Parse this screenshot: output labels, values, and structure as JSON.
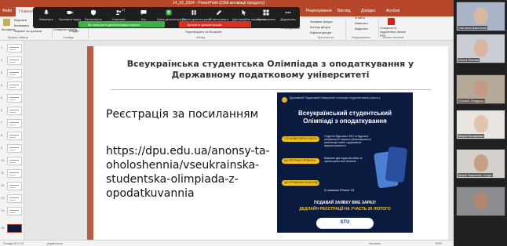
{
  "window": {
    "title": "14_02_2024 - PowerPoint (Сбій активації продукту)"
  },
  "ribbon_tabs": [
    "Файл",
    "Главная",
    "Вставка",
    "Дизайн",
    "Переходи",
    "Анімація",
    "Показ слайдів",
    "Рецензування",
    "Вигляд",
    "Довідка",
    "Acrobat"
  ],
  "ribbon": {
    "paste": "Вставити",
    "cut": "Вирізати",
    "copy": "Копіювати",
    "format": "Формат за зразком",
    "new_slide": "Створити слайд",
    "reset": "Скинути",
    "section": "Розділ",
    "clipboard_group": "Буфер обміну",
    "slides_group": "Слайди",
    "find": "Знайти",
    "replace": "Замінити",
    "select": "Виділити",
    "editing_group": "Редагування",
    "adobe": "Створити й поділитися Adobe PDF",
    "adobe_group": "Adobe Acrobat",
    "text_dir": "Напрямок тексту",
    "align_text": "Вирівняти текст",
    "smartart": "Перетворити на SmartArt",
    "paragraph_group": "Абзац",
    "arrange": "Упорядкувати",
    "quick_styles": "Експрес-стилі",
    "shape_fill": "Заливка фігури",
    "shape_outline": "Контур фігури",
    "shape_effects": "Ефекти фігури",
    "drawing_group": "Креслення"
  },
  "zoombar": {
    "buttons": [
      {
        "label": "Вимкнути",
        "color": "#ffffff"
      },
      {
        "label": "Зупинити відео",
        "color": "#ffffff"
      },
      {
        "label": "Безпечність",
        "color": "#ffffff"
      },
      {
        "label": "Учасники",
        "color": "#ffffff",
        "badge": "17"
      },
      {
        "label": "Чат",
        "color": "#ffffff"
      },
      {
        "label": "Нова демонстрація",
        "color": "#3fae49"
      },
      {
        "label": "Пауза демонстрації",
        "color": "#ffffff"
      },
      {
        "label": "Коментувати",
        "color": "#ffffff"
      },
      {
        "label": "Дистанційне керування",
        "color": "#ffffff"
      },
      {
        "label": "Приложения",
        "color": "#ffffff"
      },
      {
        "label": "Додатково",
        "color": "#ffffff"
      }
    ]
  },
  "share_status": {
    "green": "Ви запустили демонстрацію екрана",
    "red": "Зупинити демонстрацію"
  },
  "thumbnails": [
    "1",
    "2",
    "3",
    "4",
    "5",
    "6",
    "7",
    "8",
    "9",
    "10",
    "11",
    "12",
    "13",
    "14",
    "15"
  ],
  "slide": {
    "title": "Всеукраїнська студентська Олімпіада з оподаткування у Державному податковому університеті",
    "registration": "Реєстрація за посиланням",
    "url": "https://dpu.edu.ua/anonsy-ta-oholoshennia/vseukrainska-studentska-olimpiada-z-opodatkuvannia"
  },
  "poster": {
    "header": "Державний Податковий Університет оголошує студентів взяти участь у",
    "title": "Всеукраїнський студентський Олімпіаді з оподаткування",
    "badges": [
      {
        "label": "ХТО МОЖЕ ВЗЯТИ УЧАСТЬ?",
        "text": "Студенти будь-якого ЗВО та будь-якої спеціальності першого (бакалаврського) рівня вищої освіти з державною формою власності"
      },
      {
        "label": "ЩО ПОТРІБНО ЗРОБИТИ?",
        "text": "Вирішити два податкові кейси та презентувати своє бачення"
      },
      {
        "label": "ЩО ОТРИМУЄШ НА ВИХОДІ?",
        "text": ""
      }
    ],
    "prize": "3 новенькі iPhone 15",
    "cta1": "ПОДАВАЙ ЗАЯВКУ ВЖЕ ЗАРАЗ!",
    "cta2": "ДЕДЛАЙН РЕЄСТРАЦІЇ НА УЧАСТЬ 29 ЛЮТОГО",
    "logo": "STU"
  },
  "status_bar": {
    "slide_info": "Слайд 15 з 15",
    "lang": "українська",
    "notes": "Нотатки",
    "zoom": "63%"
  },
  "participants": [
    {
      "name": "Світлана Амелєєва",
      "bg": "#aab6c8",
      "face": "#d7b9a1"
    },
    {
      "name": "Ольга Пенева",
      "bg": "#c9cdd3",
      "face": "#d9b59e"
    },
    {
      "name": "Олексій Невдачко",
      "bg": "#b5a99a",
      "face": "#c49a85"
    },
    {
      "name": "Марія Засорнова",
      "bg": "#e8e4df",
      "face": "#e2c4ae"
    },
    {
      "name": "Марія Тимченко, 3 курс",
      "bg": "#d4d0cc",
      "face": "#c79f86"
    },
    {
      "name": "",
      "bg": "#8a8c90",
      "face": "#b28670"
    }
  ]
}
